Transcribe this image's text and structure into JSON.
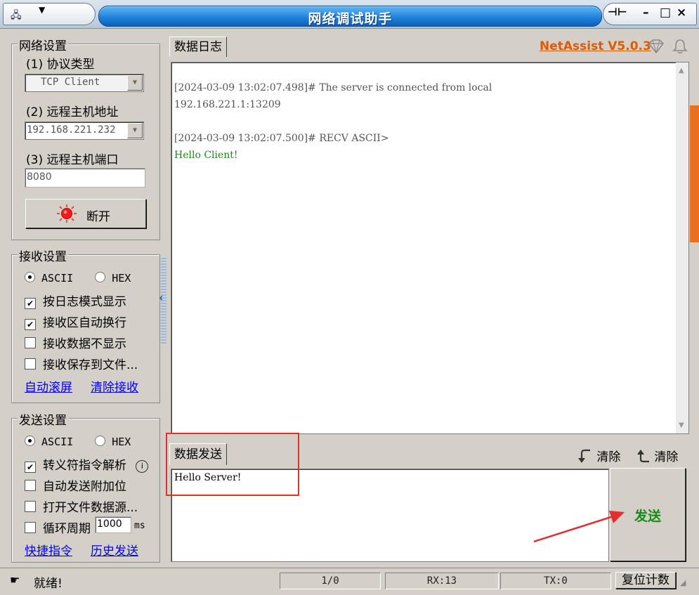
{
  "window": {
    "title": "网络调试助手",
    "icon": "network-icon",
    "controls": {
      "pin": "ⅆ",
      "minimize": "–",
      "maximize": "□",
      "close": "×"
    }
  },
  "network": {
    "group_title": "网络设置",
    "protocol_label": "(1) 协议类型",
    "protocol_value": "TCP Client",
    "host_label": "(2) 远程主机地址",
    "host_value": "192.168.221.232",
    "port_label": "(3) 远程主机端口",
    "port_value": "8080",
    "disconnect_label": "断开"
  },
  "receive": {
    "group_title": "接收设置",
    "ascii": "ASCII",
    "hex": "HEX",
    "options": [
      {
        "label": "按日志模式显示",
        "checked": true
      },
      {
        "label": "接收区自动换行",
        "checked": true
      },
      {
        "label": "接收数据不显示",
        "checked": false
      },
      {
        "label": "接收保存到文件...",
        "checked": false
      }
    ],
    "auto_scroll": "自动滚屏",
    "clear_receive": "清除接收"
  },
  "send": {
    "group_title": "发送设置",
    "ascii": "ASCII",
    "hex": "HEX",
    "options": [
      {
        "label": "转义符指令解析",
        "checked": true
      },
      {
        "label": "自动发送附加位",
        "checked": false
      },
      {
        "label": "打开文件数据源...",
        "checked": false
      }
    ],
    "cycle_label": "循环周期",
    "cycle_value": "1000",
    "cycle_unit": "ms",
    "shortcut": "快捷指令",
    "history": "历史发送"
  },
  "log": {
    "tab_label": "数据日志",
    "version": "NetAssist V5.0.3",
    "lines": [
      "[2024-03-09 13:02:07.498]# The server is connected from local",
      "192.168.221.1:13209",
      "[2024-03-09 13:02:07.500]# RECV ASCII>",
      "Hello Client!"
    ],
    "recv_color": "#1a8a1a"
  },
  "send_area": {
    "tab_label": "数据发送",
    "clear1": "清除",
    "clear2": "清除",
    "text": "Hello Server!",
    "send_button": "发送"
  },
  "status": {
    "text": "就绪!",
    "page": "1/0",
    "rx": "RX:13",
    "tx": "TX:0",
    "reset": "复位计数"
  },
  "accent_colors": {
    "title_blue": "#1e7fd8",
    "version_orange": "#e05a00",
    "highlight_red": "#e03030"
  }
}
